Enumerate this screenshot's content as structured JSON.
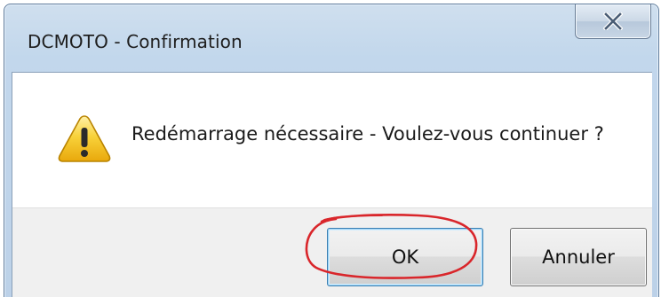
{
  "window": {
    "title": "DCMOTO - Confirmation"
  },
  "titlebar": {
    "close_icon": "close-icon",
    "close_glyph": "✕"
  },
  "message": {
    "icon": "warning-icon",
    "text": "Redémarrage nécessaire - Voulez-vous continuer ?"
  },
  "buttons": {
    "ok_label": "OK",
    "cancel_label": "Annuler"
  },
  "colors": {
    "annotation_circle": "#d9262b",
    "warning_yellow": "#f6c21a",
    "default_button_border": "#3c7fb1"
  }
}
